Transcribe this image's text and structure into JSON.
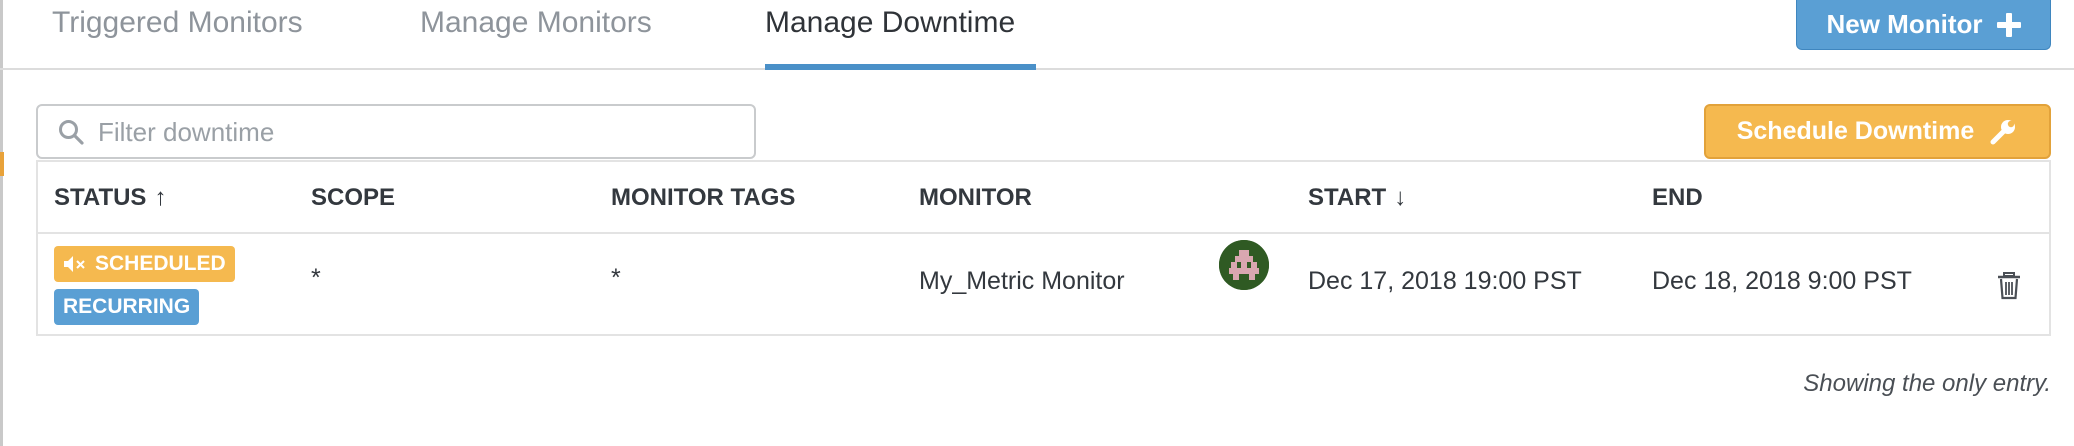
{
  "tabs": [
    {
      "label": "Triggered Monitors",
      "active": false
    },
    {
      "label": "Manage Monitors",
      "active": false
    },
    {
      "label": "Manage Downtime",
      "active": true
    }
  ],
  "toolbar": {
    "new_monitor_label": "New Monitor",
    "schedule_downtime_label": "Schedule Downtime",
    "new_monitor_color": "#5a9fd4",
    "schedule_downtime_color": "#f5b94f"
  },
  "filter": {
    "placeholder": "Filter downtime",
    "value": "",
    "icon": "search-icon"
  },
  "table": {
    "columns": [
      {
        "label": "STATUS",
        "sort": "↑"
      },
      {
        "label": "SCOPE",
        "sort": ""
      },
      {
        "label": "MONITOR TAGS",
        "sort": ""
      },
      {
        "label": "MONITOR",
        "sort": ""
      },
      {
        "label": "START",
        "sort": "↓"
      },
      {
        "label": "END",
        "sort": ""
      }
    ],
    "rows": [
      {
        "status_badges": [
          "SCHEDULED",
          "RECURRING"
        ],
        "scope": "*",
        "monitor_tags": "*",
        "monitor": "My_Metric Monitor",
        "avatar": "user-avatar",
        "start": "Dec 17, 2018 19:00 PST",
        "end": "Dec 18, 2018 9:00 PST",
        "action_icon": "trash-icon"
      }
    ]
  },
  "footer": {
    "note": "Showing the only entry."
  }
}
